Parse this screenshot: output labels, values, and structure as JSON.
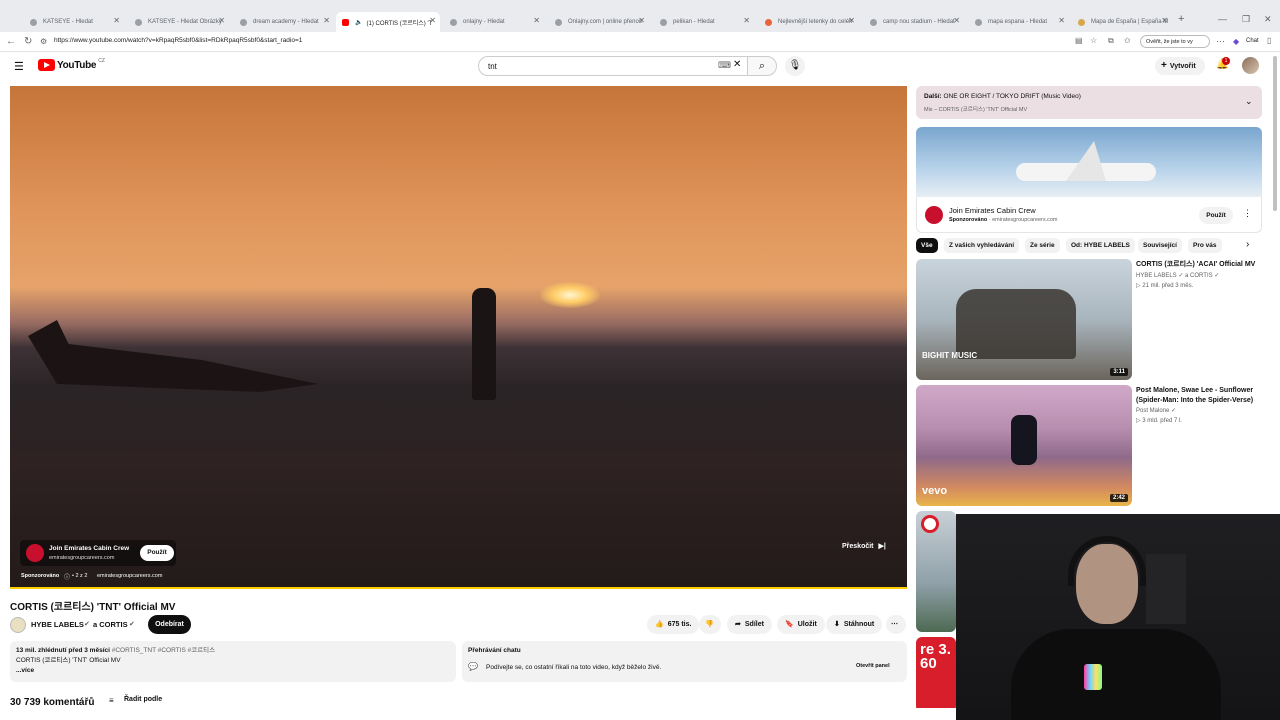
{
  "browser": {
    "tabs": [
      {
        "label": "KATSEYE - Hledat",
        "active": false
      },
      {
        "label": "KATSEYE - Hledat Obrázky",
        "active": false
      },
      {
        "label": "dream academy - Hledat",
        "active": false
      },
      {
        "label": "(1) CORTIS (코르티스) 'T",
        "active": true
      },
      {
        "label": "onlajny - Hledat",
        "active": false
      },
      {
        "label": "Onlajny.com | online přenos",
        "active": false
      },
      {
        "label": "pelikan - Hledat",
        "active": false
      },
      {
        "label": "Nejlevnější letenky do celéh",
        "active": false
      },
      {
        "label": "camp nou stadium - Hledat",
        "active": false
      },
      {
        "label": "mapa espana - Hledat",
        "active": false
      },
      {
        "label": "Mapa de España | España M",
        "active": false
      }
    ],
    "new_tab": "+",
    "url": "https://www.youtube.com/watch?v=kRpaqR5sbf0&list=RDkRpaqR5sbf0&start_radio=1",
    "verify_label": "Ověřit, že jste to vy",
    "chat_label": "Chat"
  },
  "header": {
    "logo_text": "YouTube",
    "logo_region": "CZ",
    "search_value": "tnt",
    "create_label": "Vytvořit",
    "notification_count": "1"
  },
  "player": {
    "ad": {
      "title": "Join Emirates Cabin Crew",
      "domain": "emiratesgroupcareers.com",
      "button": "Použít",
      "sponsored": "Sponzorováno",
      "counter": "• 2 z 2",
      "domain2": "emiratesgroupcareers.com"
    },
    "skip_label": "Přeskočit",
    "progress": 1.0
  },
  "video": {
    "title": "CORTIS (코르티스) 'TNT' Official MV",
    "channel": "HYBE LABELS",
    "collab": "a CORTIS",
    "subscribe_label": "Odebírat",
    "likes": "675 tis.",
    "share_label": "Sdílet",
    "save_label": "Uložit",
    "download_label": "Stáhnout",
    "views_date": "13 mil. zhlédnutí  před 3 měsíci",
    "hashtags": "#CORTIS_TNT #CORTIS #코르티스",
    "desc_line": "CORTIS (코르티스) 'TNT' Official MV",
    "more_label": "...více",
    "chat_title": "Přehrávání chatu",
    "chat_text": "Podívejte se, co ostatní říkali na toto video, když běželo živě.",
    "chat_open": "Otevřít panel",
    "comments_count": "30 739 komentářů",
    "sort_label": "Řadit podle"
  },
  "sidebar": {
    "next_label": "Další:",
    "next_title": "ONE OR EIGHT / TOKYO DRIFT (Music Video)",
    "next_sub": "Mix – CORTIS (코르티스) 'TNT' Official MV",
    "ad_title": "Join Emirates Cabin Crew",
    "ad_sponsored": "Sponzorováno",
    "ad_domain": "emiratesgroupcareers.com",
    "ad_button": "Použít",
    "chips": [
      "Vše",
      "Z vašich vyhledávání",
      "Ze série",
      "Od: HYBE LABELS",
      "Související",
      "Pro vás"
    ],
    "videos": [
      {
        "title": "CORTIS (코르티스) 'ACAI' Official MV",
        "channel": "HYBE LABELS ✓ a CORTIS ✓",
        "meta": "▷ 21 mil.  před 3 měs.",
        "duration": "3:11",
        "brand": "BIGHIT MUSIC"
      },
      {
        "title": "Post Malone, Swae Lee - Sunflower (Spider-Man: Into the Spider-Verse)",
        "channel": "Post Malone ✓",
        "meta": "▷ 3 mld.  před 7 l.",
        "duration": "2:42",
        "brand": "vevo"
      },
      {
        "title": "",
        "channel": "",
        "meta": "",
        "duration": "",
        "brand": ""
      },
      {
        "title": "",
        "channel": "",
        "meta": "",
        "duration": "",
        "brand": "re 3.60"
      }
    ]
  },
  "colors": {
    "youtube_red": "#ff0000",
    "progress_yellow": "#ffcc00",
    "subscribe_bg": "#0f0f0f"
  }
}
